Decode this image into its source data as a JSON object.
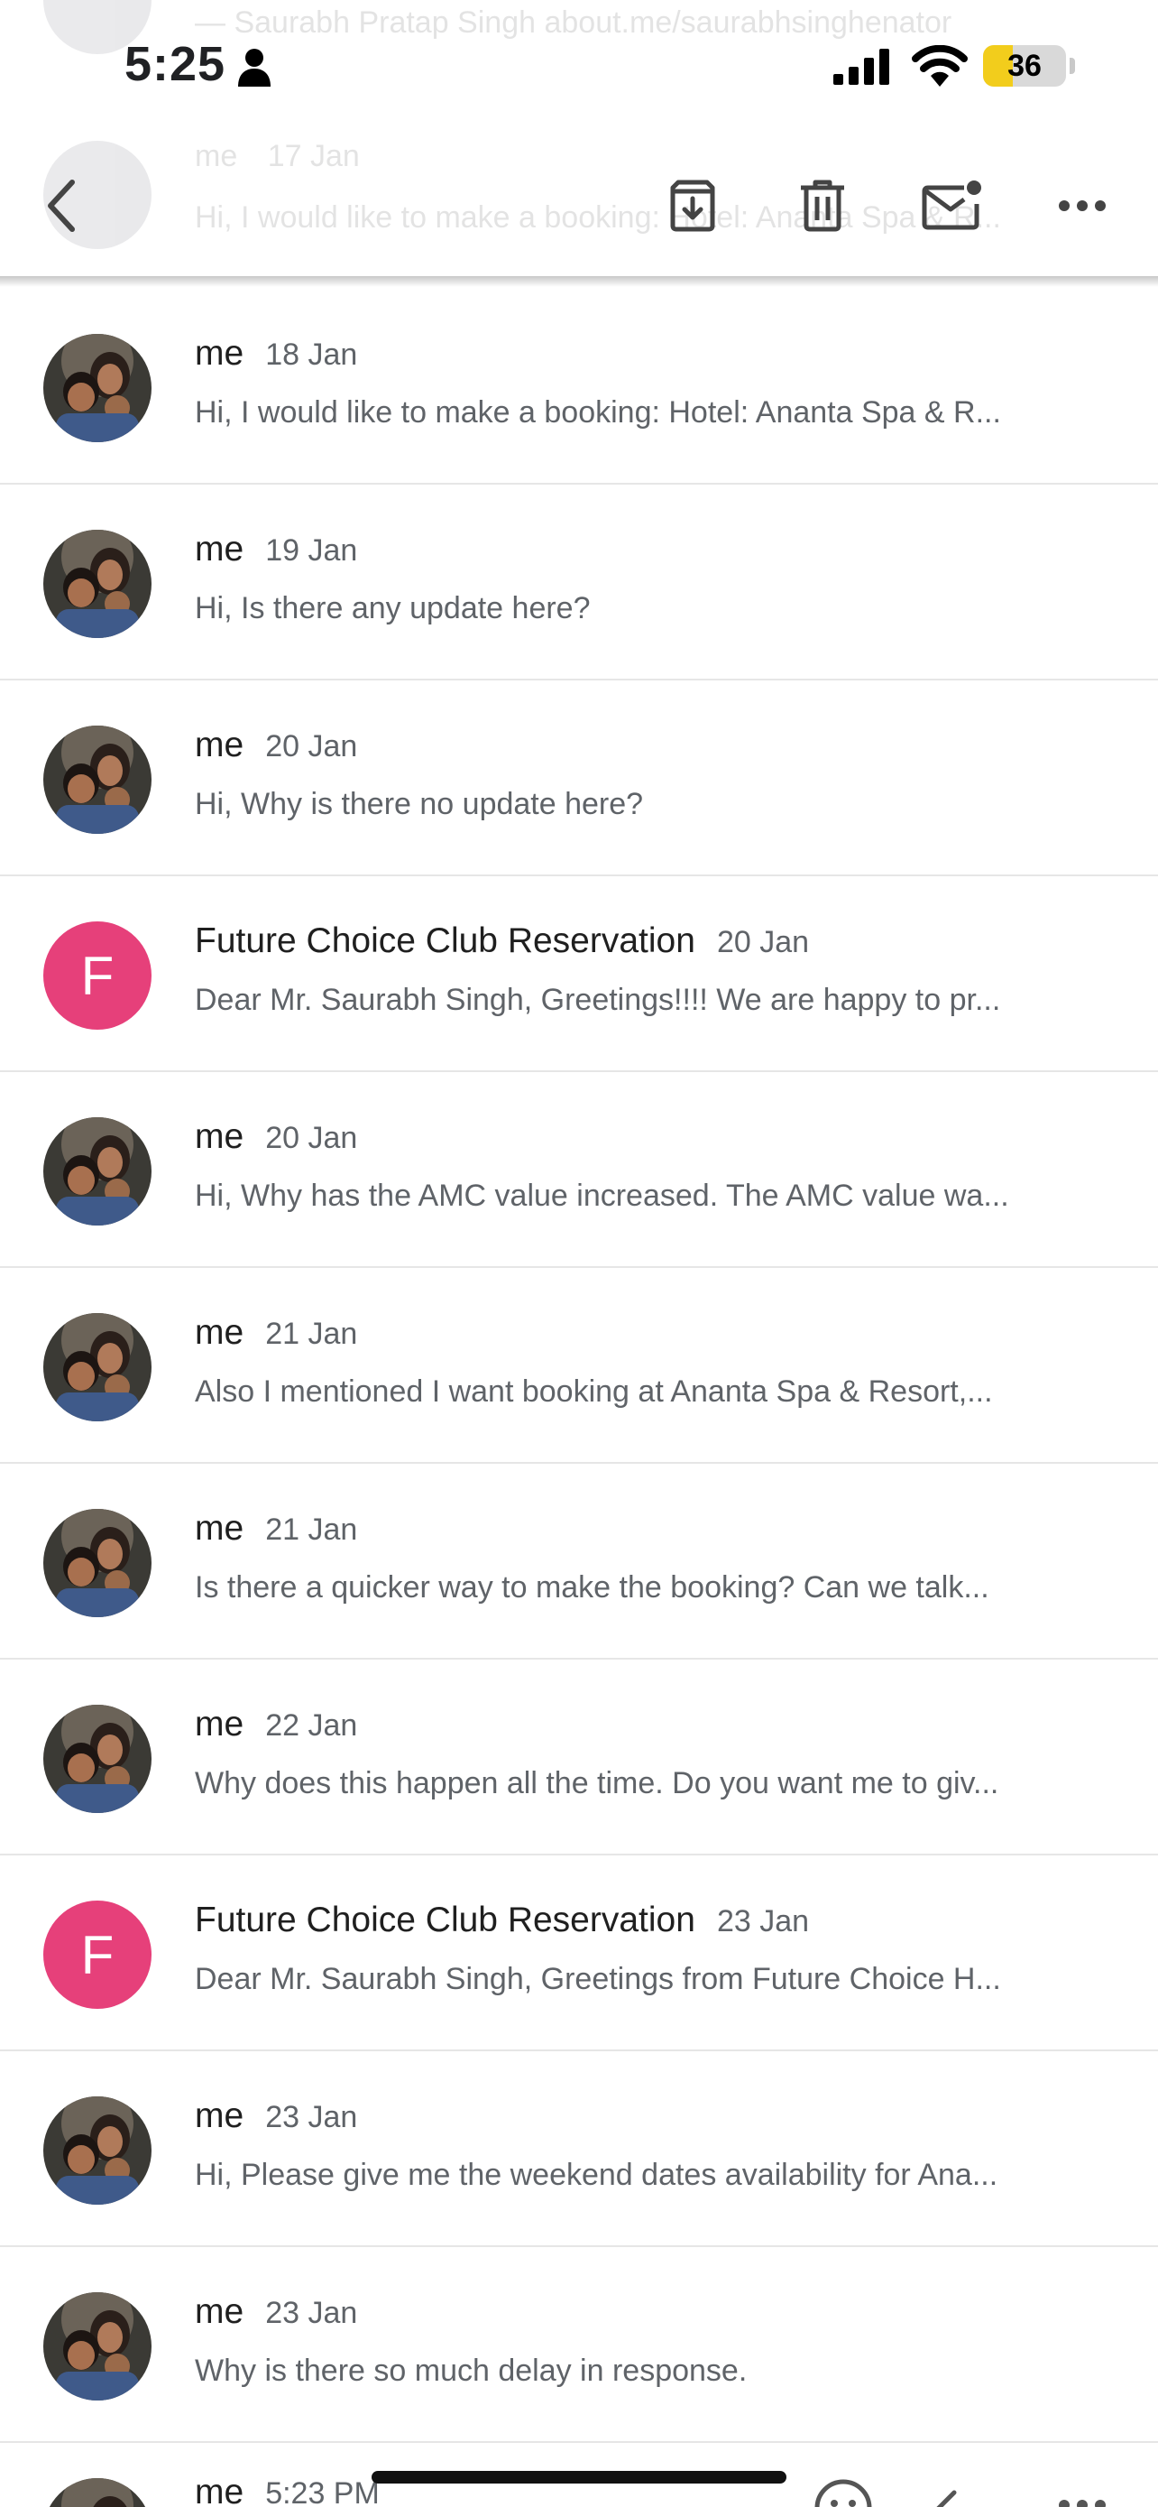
{
  "status_bar": {
    "time": "5:25",
    "battery": "36",
    "battery_level": 0.36
  },
  "background_rows": [
    {
      "text": "— Saurabh Pratap Singh about.me/saurabhsinghenator"
    },
    {
      "sender": "me",
      "date": "17 Jan",
      "snippet": "Hi, I would like to make a booking: Hotel: Ananta Spa & R..."
    }
  ],
  "header": {
    "back_icon": "chevron-left-icon",
    "archive_icon": "archive-icon",
    "delete_icon": "trash-icon",
    "unread_icon": "mark-unread-icon",
    "more_icon": "more-horizontal-icon"
  },
  "messages": [
    {
      "sender": "me",
      "date": "18 Jan",
      "snippet": "Hi, I would like to make a booking: Hotel: Ananta Spa & R...",
      "avatar": "photo"
    },
    {
      "sender": "me",
      "date": "19 Jan",
      "snippet": "Hi, Is there any update here?",
      "avatar": "photo"
    },
    {
      "sender": "me",
      "date": "20 Jan",
      "snippet": "Hi, Why is there no update here?",
      "avatar": "photo"
    },
    {
      "sender": "Future Choice Club Reservation",
      "date": "20 Jan",
      "snippet": "Dear Mr. Saurabh Singh, Greetings!!!! We are happy to pr...",
      "avatar": "letter",
      "letter": "F"
    },
    {
      "sender": "me",
      "date": "20 Jan",
      "snippet": "Hi, Why has the AMC value increased. The AMC value wa...",
      "avatar": "photo"
    },
    {
      "sender": "me",
      "date": "21 Jan",
      "snippet": "Also I mentioned I want booking at Ananta Spa & Resort,...",
      "avatar": "photo"
    },
    {
      "sender": "me",
      "date": "21 Jan",
      "snippet": "Is there a quicker way to make the booking? Can we talk...",
      "avatar": "photo"
    },
    {
      "sender": "me",
      "date": "22 Jan",
      "snippet": "Why does this happen all the time. Do you want me to giv...",
      "avatar": "photo"
    },
    {
      "sender": "Future Choice Club Reservation",
      "date": "23 Jan",
      "snippet": "Dear Mr. Saurabh Singh, Greetings from Future Choice H...",
      "avatar": "letter",
      "letter": "F"
    },
    {
      "sender": "me",
      "date": "23 Jan",
      "snippet": "Hi, Please give me the weekend dates availability for Ana...",
      "avatar": "photo"
    },
    {
      "sender": "me",
      "date": "23 Jan",
      "snippet": "Why is there so much delay in response.",
      "avatar": "photo"
    }
  ],
  "last_message": {
    "sender": "me",
    "date": "5:23 PM"
  },
  "colors": {
    "letter_avatar": "#e6407a",
    "battery_fill": "#f2cd1c"
  }
}
